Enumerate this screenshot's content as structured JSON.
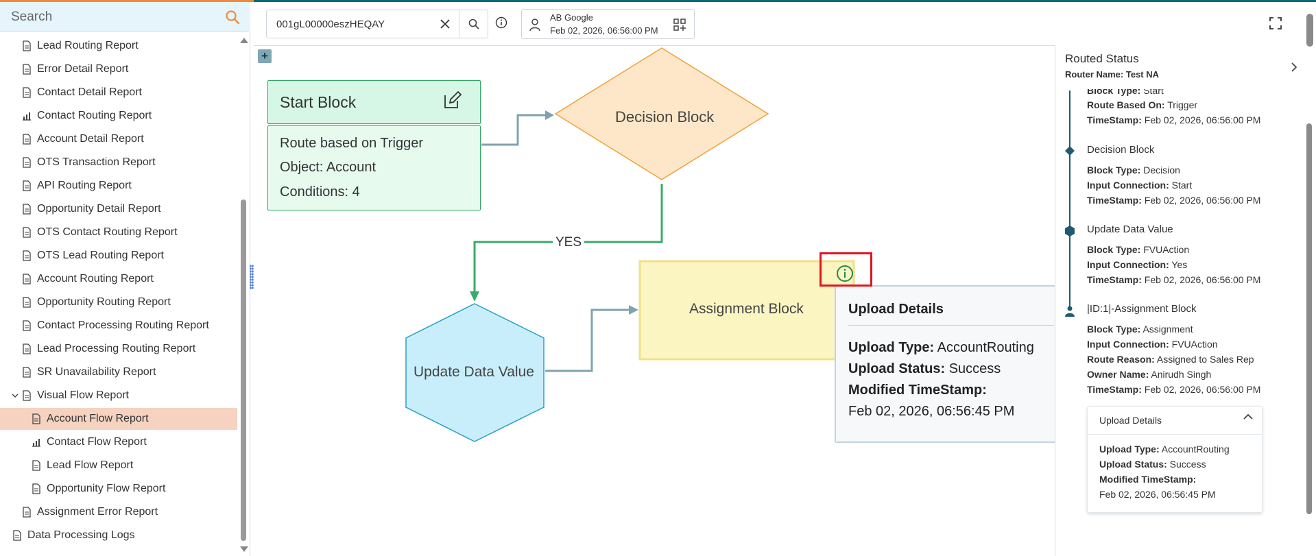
{
  "sidebar": {
    "search_placeholder": "Search",
    "items": [
      {
        "label": "Lead Routing Report",
        "icon": "report-icon"
      },
      {
        "label": "Error Detail Report",
        "icon": "report-icon"
      },
      {
        "label": "Contact Detail Report",
        "icon": "report-icon"
      },
      {
        "label": "Contact Routing Report",
        "icon": "chart-icon"
      },
      {
        "label": "Account Detail Report",
        "icon": "report-icon"
      },
      {
        "label": "OTS Transaction Report",
        "icon": "report-icon"
      },
      {
        "label": "API Routing Report",
        "icon": "report-icon"
      },
      {
        "label": "Opportunity Detail Report",
        "icon": "report-icon"
      },
      {
        "label": "OTS Contact Routing Report",
        "icon": "report-icon"
      },
      {
        "label": "OTS Lead Routing Report",
        "icon": "report-icon"
      },
      {
        "label": "Account Routing Report",
        "icon": "report-icon"
      },
      {
        "label": "Opportunity Routing Report",
        "icon": "report-icon"
      },
      {
        "label": "Contact Processing Routing Report",
        "icon": "report-icon"
      },
      {
        "label": "Lead Processing Routing Report",
        "icon": "report-icon"
      },
      {
        "label": "SR Unavailability Report",
        "icon": "report-icon"
      }
    ],
    "visual_flow": {
      "label": "Visual Flow Report",
      "children": [
        {
          "label": "Account Flow Report",
          "active": true
        },
        {
          "label": "Contact Flow Report"
        },
        {
          "label": "Lead Flow Report"
        },
        {
          "label": "Opportunity Flow Report"
        }
      ]
    },
    "assignment_error": "Assignment Error Report",
    "data_processing": "Data Processing Logs"
  },
  "toolbar": {
    "record_id": "001gL00000eszHEQAY",
    "account_name": "AB Google",
    "account_date": "Feb 02, 2026, 06:56:00 PM"
  },
  "canvas": {
    "start_block": {
      "title": "Start Block",
      "lines": [
        "Route based on Trigger",
        "Object: Account",
        "Conditions: 4"
      ]
    },
    "decision_block": "Decision Block",
    "update_block": "Update Data Value",
    "assignment_block": "Assignment Block",
    "yes_label": "YES",
    "popup": {
      "title": "Upload Details",
      "upload_type_label": "Upload Type:",
      "upload_type": "AccountRouting",
      "upload_status_label": "Upload Status:",
      "upload_status": "Success",
      "modified_label": "Modified TimeStamp:",
      "modified": "Feb 02, 2026, 06:56:45 PM"
    }
  },
  "routed_status": {
    "title": "Routed Status",
    "router_label": "Router Name:",
    "router_name": "Test NA",
    "start_partial": {
      "block_type_label": "Block Type:",
      "block_type": "Start",
      "route_label": "Route Based On:",
      "route": "Trigger",
      "ts_label": "TimeStamp:",
      "ts": "Feb 02, 2026, 06:56:00 PM"
    },
    "decision": {
      "title": "Decision Block",
      "block_type": "Decision",
      "input": "Start",
      "ts": "Feb 02, 2026, 06:56:00 PM"
    },
    "update": {
      "title": "Update Data Value",
      "block_type": "FVUAction",
      "input": "Yes",
      "ts": "Feb 02, 2026, 06:56:00 PM"
    },
    "assignment": {
      "title": "|ID:1|-Assignment Block",
      "block_type": "Assignment",
      "input": "FVUAction",
      "reason": "Assigned to Sales Rep",
      "owner": "Anirudh Singh",
      "ts": "Feb 02, 2026, 06:56:00 PM"
    },
    "labels": {
      "block_type": "Block Type:",
      "input": "Input Connection:",
      "ts": "TimeStamp:",
      "reason": "Route Reason:",
      "owner": "Owner Name:"
    },
    "upload_card": {
      "title": "Upload Details",
      "type_label": "Upload Type:",
      "type": "AccountRouting",
      "status_label": "Upload Status:",
      "status": "Success",
      "modified_label": "Modified TimeStamp:",
      "modified": "Feb 02, 2026, 06:56:45 PM"
    }
  },
  "colors": {
    "accent": "#0b6a7a",
    "start_fill": "#d6f7e5",
    "decision_fill": "#fde7c8",
    "update_fill": "#c9eefb",
    "assignment_fill": "#fbf5c2",
    "highlight": "#e3131b",
    "yes_arrow": "#3aab6a",
    "arrow": "#7fa3ae"
  }
}
